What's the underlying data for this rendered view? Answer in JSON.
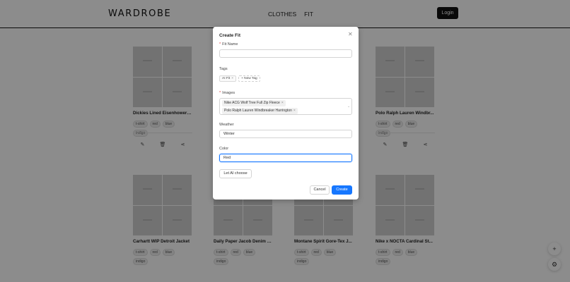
{
  "header": {
    "logo": "WARDROBE",
    "nav": [
      "CLOTHES",
      "FIT"
    ],
    "login_label": "Login"
  },
  "cards": [
    {
      "title": "Dickies Lined Eisenhower J...",
      "tags": [
        "t-shirt",
        "red",
        "blue",
        "indigo"
      ]
    },
    {
      "title": "",
      "tags": []
    },
    {
      "title": "",
      "tags": []
    },
    {
      "title": "Polo Ralph Lauren Windbr...",
      "tags": [
        "t-shirt",
        "red",
        "blue",
        "indigo"
      ]
    },
    {
      "title": "Carhartt WIP Detroit Jacket",
      "tags": [
        "t-shirt",
        "red",
        "blue",
        "indigo"
      ]
    },
    {
      "title": "Daily Paper Jacob Denim J...",
      "tags": [
        "t-shirt",
        "red",
        "blue",
        "indigo"
      ]
    },
    {
      "title": "Montane Spirit Gore-Tex J...",
      "tags": [
        "t-shirt",
        "red",
        "blue",
        "indigo"
      ]
    },
    {
      "title": "Nike x NOCTA Cardinal St...",
      "tags": [
        "t-shirt",
        "red",
        "blue",
        "indigo"
      ]
    }
  ],
  "modal": {
    "title": "Create Fit",
    "fit_name": {
      "label": "Fit Name",
      "value": ""
    },
    "tags": {
      "label": "Tags",
      "items": [
        "AI Fit"
      ],
      "new_tag_label": "+ New Tag"
    },
    "images": {
      "label": "Images",
      "items": [
        "Nike ACG Wolf Tree Full Zip Fleece",
        "Polo Ralph Lauren Windbreaker Harrington"
      ]
    },
    "weather": {
      "label": "Weather",
      "value": "Winter"
    },
    "color": {
      "label": "Color",
      "value": "Red"
    },
    "ai_button": "Let AI choose",
    "cancel_label": "Cancel",
    "create_label": "Create"
  },
  "fab": {
    "add_symbol": "+",
    "settings_symbol": "⚙"
  },
  "colors": {
    "primary": "#1677ff",
    "required": "#e03131"
  }
}
